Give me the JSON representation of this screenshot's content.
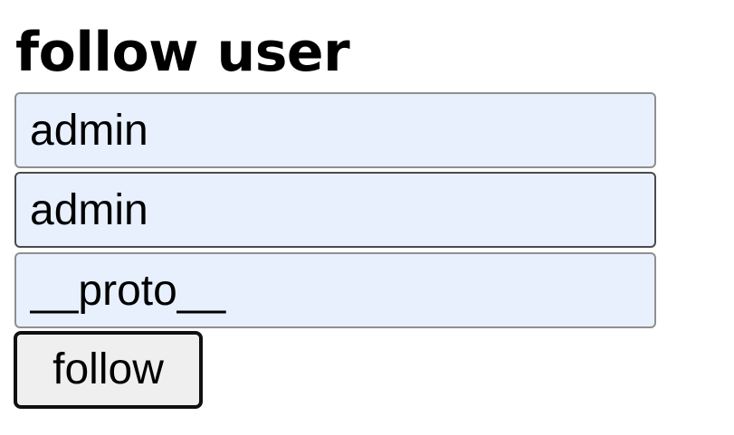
{
  "page": {
    "title": "follow user"
  },
  "form": {
    "fields": [
      {
        "value": "admin"
      },
      {
        "value": "admin"
      },
      {
        "value": "__proto__"
      }
    ],
    "submit_label": "follow",
    "colors": {
      "autofill_background": "#e8f0fe",
      "button_background": "#efefef"
    }
  }
}
